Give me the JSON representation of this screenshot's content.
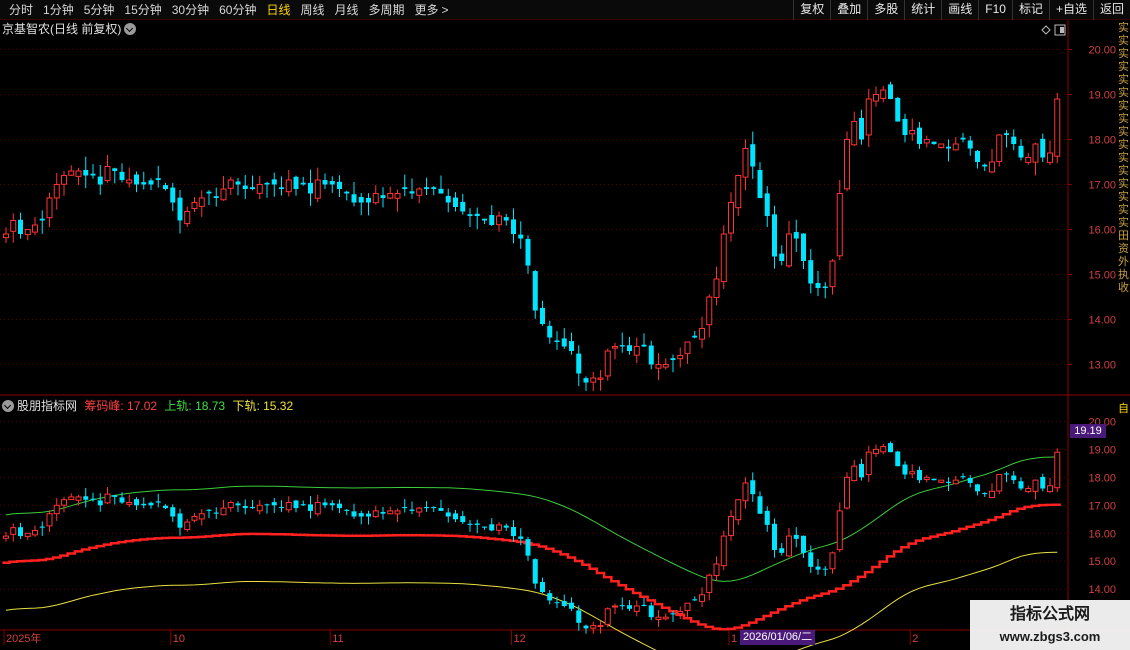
{
  "toolbar": {
    "periods": [
      "分时",
      "1分钟",
      "5分钟",
      "15分钟",
      "30分钟",
      "60分钟",
      "日线",
      "周线",
      "月线",
      "多周期",
      "更多"
    ],
    "active_period": "日线",
    "more_arrow": ">",
    "right_buttons": [
      "复权",
      "叠加",
      "多股",
      "统计",
      "画线",
      "F10",
      "标记",
      "+自选",
      "返回"
    ]
  },
  "main_pane": {
    "title": "京基智农(日线 前复权)",
    "y_ticks": [
      "20.00",
      "19.00",
      "18.00",
      "17.00",
      "16.00",
      "15.00",
      "14.00",
      "13.00"
    ]
  },
  "indicator_pane": {
    "name": "股朋指标网",
    "label_chip": "筹码峰: 17.02",
    "label_upper": "上轨: 18.73",
    "label_lower": "下轨: 15.32",
    "y_ticks": [
      "20.00",
      "19.00",
      "18.00",
      "17.00",
      "16.00",
      "15.00",
      "14.00"
    ],
    "price_tag": "19.19"
  },
  "x_axis": {
    "labels": [
      "2025年",
      "10",
      "11",
      "12",
      "1",
      "2"
    ],
    "crosshair_date": "2026/01/06/二"
  },
  "side_strip": [
    "实",
    "实",
    "实",
    "实",
    "实",
    "实",
    "实",
    "实",
    "实",
    "实",
    "实",
    "实",
    "实",
    "实",
    "实",
    "实",
    "田",
    "资",
    "外",
    "执",
    "收"
  ],
  "side_strip2": "自",
  "watermark": {
    "line1": "指标公式网",
    "line2": "www.zbgs3.com"
  },
  "colors": {
    "up": "#ff3232",
    "down": "#00e5ff",
    "upper_band": "#3ccc3c",
    "lower_band": "#e8e040",
    "chip_peak": "#ff2020",
    "grid": "#5a0000"
  },
  "chart_data": {
    "type": "candlestick",
    "closes": [
      15.9,
      16.2,
      15.9,
      16.0,
      16.1,
      16.2,
      16.7,
      17.0,
      17.2,
      17.3,
      17.3,
      17.2,
      17.2,
      17.0,
      17.4,
      17.3,
      17.1,
      17.1,
      17.0,
      17.0,
      17.0,
      17.1,
      16.9,
      16.6,
      16.2,
      16.4,
      16.6,
      16.7,
      16.8,
      16.7,
      16.9,
      17.1,
      17.0,
      16.9,
      16.9,
      17.0,
      17.0,
      17.0,
      16.9,
      17.1,
      16.9,
      17.0,
      16.8,
      17.1,
      17.0,
      17.0,
      16.9,
      16.8,
      16.6,
      16.6,
      16.6,
      16.8,
      16.7,
      16.8,
      16.8,
      16.9,
      16.8,
      16.9,
      16.9,
      16.9,
      16.8,
      16.6,
      16.5,
      16.4,
      16.3,
      16.3,
      16.2,
      16.1,
      16.3,
      16.2,
      15.9,
      15.8,
      15.2,
      14.2,
      13.9,
      13.6,
      13.5,
      13.4,
      13.3,
      12.8,
      12.6,
      12.7,
      12.7,
      13.3,
      13.4,
      13.4,
      13.3,
      13.4,
      13.4,
      13.0,
      13.0,
      13.0,
      13.1,
      13.2,
      13.5,
      13.6,
      13.8,
      14.5,
      14.9,
      15.9,
      16.6,
      17.2,
      17.8,
      17.4,
      16.7,
      16.3,
      15.4,
      15.3,
      15.9,
      15.8,
      15.3,
      14.8,
      14.7,
      14.7,
      15.3,
      16.8,
      18.0,
      18.4,
      18.0,
      18.9,
      19.0,
      19.1,
      18.9,
      18.4,
      18.1,
      18.2,
      17.9,
      18.0,
      17.9,
      17.9,
      17.8,
      17.9,
      18.0,
      17.8,
      17.5,
      17.4,
      17.5,
      18.1,
      18.1,
      17.9,
      17.6,
      17.6,
      17.9,
      17.6,
      17.7,
      18.9
    ],
    "y_range_main": [
      12.3,
      20.3
    ],
    "y_range_indicator": [
      13.4,
      20.3
    ],
    "upper_band_last": 18.73,
    "lower_band_last": 15.32,
    "chip_peak_last": 17.02
  }
}
